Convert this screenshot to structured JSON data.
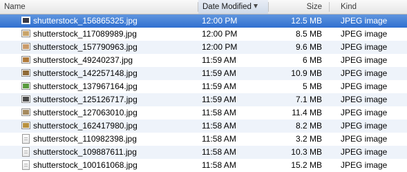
{
  "columns": {
    "name": "Name",
    "date": "Date Modified",
    "size": "Size",
    "kind": "Kind",
    "sorted_by": "date",
    "sort_direction": "descending"
  },
  "files": [
    {
      "name": "shutterstock_156865325.jpg",
      "date": "12:00 PM",
      "size": "12.5 MB",
      "kind": "JPEG image",
      "icon": "image-thumbnail-icon",
      "thumb_color": "#3a3a46",
      "selected": true
    },
    {
      "name": "shutterstock_117089989.jpg",
      "date": "12:00 PM",
      "size": "8.5 MB",
      "kind": "JPEG image",
      "icon": "image-thumbnail-icon",
      "thumb_color": "#c9a46a",
      "selected": false
    },
    {
      "name": "shutterstock_157790963.jpg",
      "date": "12:00 PM",
      "size": "9.6 MB",
      "kind": "JPEG image",
      "icon": "image-thumbnail-icon",
      "thumb_color": "#c99b6a",
      "selected": false
    },
    {
      "name": "shutterstock_49240237.jpg",
      "date": "11:59 AM",
      "size": "6 MB",
      "kind": "JPEG image",
      "icon": "image-thumbnail-icon",
      "thumb_color": "#b07a3a",
      "selected": false
    },
    {
      "name": "shutterstock_142257148.jpg",
      "date": "11:59 AM",
      "size": "10.9 MB",
      "kind": "JPEG image",
      "icon": "image-thumbnail-icon",
      "thumb_color": "#8f6a36",
      "selected": false
    },
    {
      "name": "shutterstock_137967164.jpg",
      "date": "11:59 AM",
      "size": "5 MB",
      "kind": "JPEG image",
      "icon": "image-thumbnail-icon",
      "thumb_color": "#5a9a3e",
      "selected": false
    },
    {
      "name": "shutterstock_125126717.jpg",
      "date": "11:59 AM",
      "size": "7.1 MB",
      "kind": "JPEG image",
      "icon": "image-thumbnail-icon",
      "thumb_color": "#4a4a4a",
      "selected": false
    },
    {
      "name": "shutterstock_127063010.jpg",
      "date": "11:58 AM",
      "size": "11.4 MB",
      "kind": "JPEG image",
      "icon": "image-thumbnail-icon",
      "thumb_color": "#a58a5e",
      "selected": false
    },
    {
      "name": "shutterstock_162417980.jpg",
      "date": "11:58 AM",
      "size": "8.2 MB",
      "kind": "JPEG image",
      "icon": "image-thumbnail-icon",
      "thumb_color": "#b8913f",
      "selected": false
    },
    {
      "name": "shutterstock_110982398.jpg",
      "date": "11:58 AM",
      "size": "3.2 MB",
      "kind": "JPEG image",
      "icon": "jpeg-document-icon",
      "thumb_color": "#b0b0b0",
      "selected": false
    },
    {
      "name": "shutterstock_109887611.jpg",
      "date": "11:58 AM",
      "size": "10.3 MB",
      "kind": "JPEG image",
      "icon": "jpeg-document-icon",
      "thumb_color": "#b0b0b0",
      "selected": false
    },
    {
      "name": "shutterstock_100161068.jpg",
      "date": "11:58 AM",
      "size": "15.2 MB",
      "kind": "JPEG image",
      "icon": "jpeg-document-icon",
      "thumb_color": "#b0b0b0",
      "selected": false
    }
  ]
}
